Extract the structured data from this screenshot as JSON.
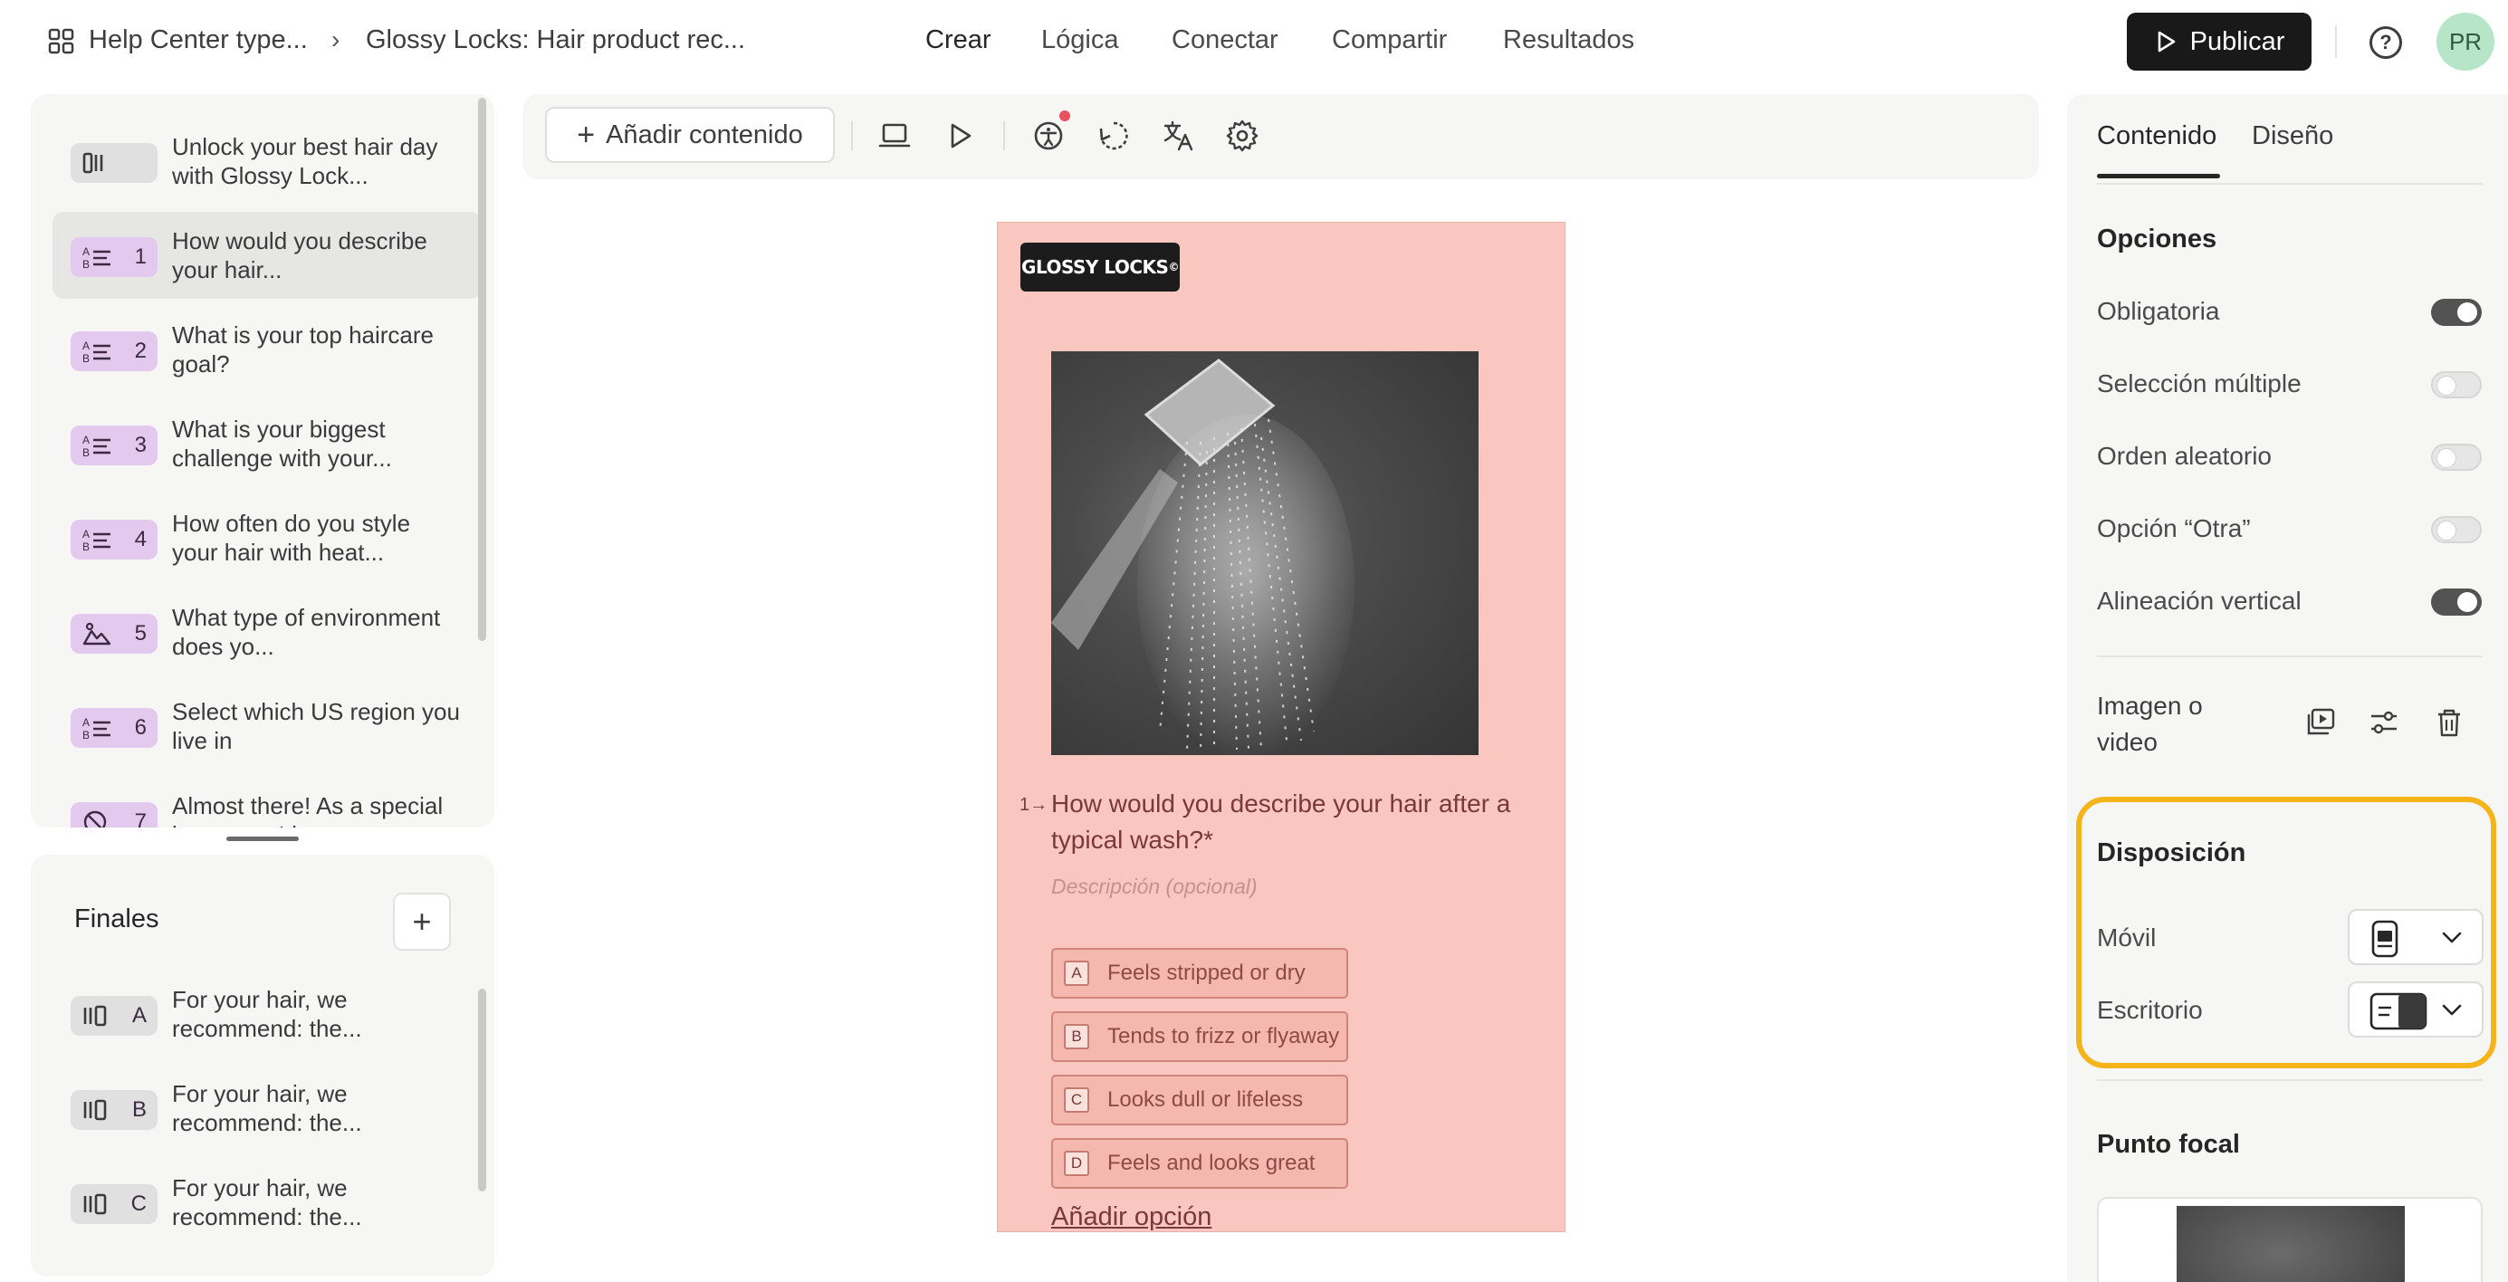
{
  "topbar": {
    "breadcrumb_1": "Help Center type...",
    "breadcrumb_2": "Glossy Locks: Hair product rec...",
    "nav": [
      "Crear",
      "Lógica",
      "Conectar",
      "Compartir",
      "Resultados"
    ],
    "active_nav": "Crear",
    "publish_label": "Publicar",
    "avatar_initials": "PR"
  },
  "questions": [
    {
      "badge": "",
      "type": "welcome",
      "text": "Unlock your best hair day with Glossy Lock..."
    },
    {
      "badge": "1",
      "type": "multiple-choice",
      "text": "How would you describe your hair..."
    },
    {
      "badge": "2",
      "type": "multiple-choice",
      "text": "What is your top haircare goal?"
    },
    {
      "badge": "3",
      "type": "multiple-choice",
      "text": "What is your biggest challenge with your..."
    },
    {
      "badge": "4",
      "type": "multiple-choice",
      "text": "How often do you style your hair with heat..."
    },
    {
      "badge": "5",
      "type": "picture-choice",
      "text": "What type of environment does yo..."
    },
    {
      "badge": "6",
      "type": "multiple-choice",
      "text": "Select which US region you live in"
    },
    {
      "badge": "7",
      "type": "statement",
      "text": "Almost there! As a special bonus, we'd..."
    }
  ],
  "endings": {
    "title": "Finales",
    "items": [
      {
        "badge": "A",
        "text": "For your hair, we recommend: the..."
      },
      {
        "badge": "B",
        "text": "For your hair, we recommend: the..."
      },
      {
        "badge": "C",
        "text": "For your hair, we recommend: the..."
      }
    ]
  },
  "toolbar": {
    "add_content_label": "Añadir contenido"
  },
  "preview": {
    "logo_text": "GLOSSY LOCKS",
    "logo_mark": "©",
    "question_number": "1→",
    "question_title": "How would you describe your hair after a typical wash?*",
    "description_placeholder": "Descripción (opcional)",
    "choices": [
      {
        "key": "A",
        "label": "Feels stripped or dry"
      },
      {
        "key": "B",
        "label": "Tends to frizz or flyaway"
      },
      {
        "key": "C",
        "label": "Looks dull or lifeless"
      },
      {
        "key": "D",
        "label": "Feels and looks great"
      }
    ],
    "add_option": "Añadir opción"
  },
  "right_panel": {
    "tabs": [
      "Contenido",
      "Diseño"
    ],
    "active_tab": "Contenido",
    "options_title": "Opciones",
    "options": [
      {
        "label": "Obligatoria",
        "on": true
      },
      {
        "label": "Selección múltiple",
        "on": false
      },
      {
        "label": "Orden aleatorio",
        "on": false
      },
      {
        "label": "Opción “Otra”",
        "on": false
      },
      {
        "label": "Alineación vertical",
        "on": true
      }
    ],
    "media_label": "Imagen o video",
    "layout_title": "Disposición",
    "layout_mobile": "Móvil",
    "layout_desktop": "Escritorio",
    "focal_title": "Punto focal"
  },
  "colors": {
    "preview_bg": "#f9c7c0",
    "accent_text": "#7a3838",
    "badge_purple": "#e4c9ee",
    "highlight": "#f4b41a",
    "publish_bg": "#191919"
  }
}
